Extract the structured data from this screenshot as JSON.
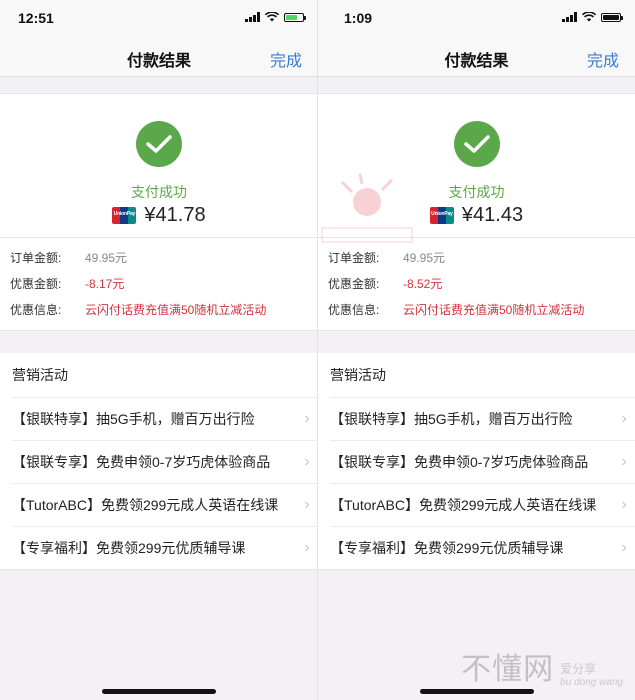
{
  "screens": [
    {
      "status": {
        "time": "12:51",
        "battery_color": "#4cd964"
      },
      "nav": {
        "title": "付款结果",
        "done": "完成"
      },
      "result": {
        "status_text": "支付成功",
        "amount": "¥41.78"
      },
      "details": [
        {
          "label": "订单金额:",
          "value": "49.95元"
        },
        {
          "label": "优惠金额:",
          "value": "-8.17元"
        },
        {
          "label": "优惠信息:",
          "value": "云闪付话费充值满50随机立减活动"
        }
      ],
      "marketing": {
        "heading": "营销活动",
        "items": [
          "【银联特享】抽5G手机，赠百万出行险",
          "【银联专享】免费申领0-7岁巧虎体验商品",
          "【TutorABC】免费领299元成人英语在线课",
          "【专享福利】免费领299元优质辅导课"
        ]
      }
    },
    {
      "status": {
        "time": "1:09",
        "battery_color": "#111111"
      },
      "nav": {
        "title": "付款结果",
        "done": "完成"
      },
      "result": {
        "status_text": "支付成功",
        "amount": "¥41.43"
      },
      "details": [
        {
          "label": "订单金额:",
          "value": "49.95元"
        },
        {
          "label": "优惠金额:",
          "value": "-8.52元"
        },
        {
          "label": "优惠信息:",
          "value": "云闪付话费充值满50随机立减活动"
        }
      ],
      "marketing": {
        "heading": "营销活动",
        "items": [
          "【银联特享】抽5G手机，赠百万出行险",
          "【银联专享】免费申领0-7岁巧虎体验商品",
          "【TutorABC】免费领299元成人英语在线课",
          "【专享福利】免费领299元优质辅导课"
        ]
      }
    }
  ],
  "card_logo_text": "UnionPay",
  "watermark": {
    "main": "不懂网",
    "sub1": "爱分享",
    "sub2": "bu dong wang"
  },
  "colors": {
    "accent_blue": "#3a7bd5",
    "success_green": "#5aa84a",
    "discount_red": "#d2323a"
  }
}
